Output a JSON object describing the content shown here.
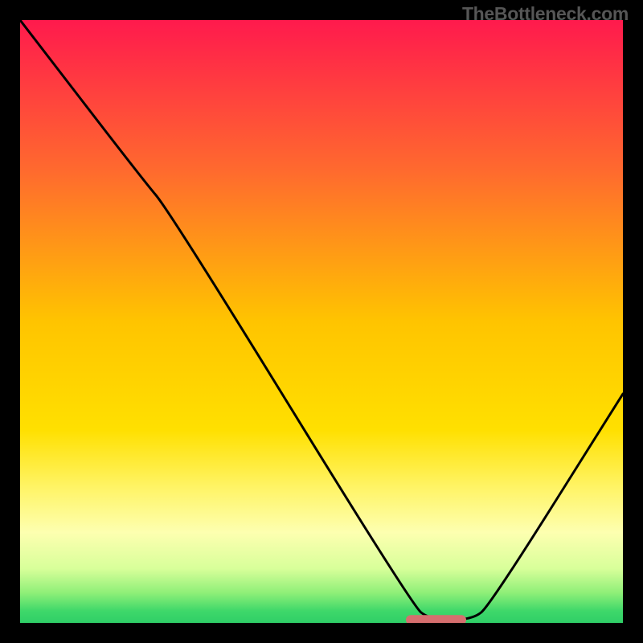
{
  "watermark": "TheBottleneck.com",
  "chart_data": {
    "type": "line",
    "title": "",
    "xlabel": "",
    "ylabel": "",
    "xlim": [
      0,
      100
    ],
    "ylim": [
      0,
      100
    ],
    "gradient_stops": [
      {
        "offset": 0,
        "color": "#ff1a4d"
      },
      {
        "offset": 25,
        "color": "#ff6a2e"
      },
      {
        "offset": 50,
        "color": "#ffc400"
      },
      {
        "offset": 68,
        "color": "#ffe000"
      },
      {
        "offset": 78,
        "color": "#fff56b"
      },
      {
        "offset": 85,
        "color": "#fdffb0"
      },
      {
        "offset": 91,
        "color": "#d8ff9a"
      },
      {
        "offset": 95,
        "color": "#8fef78"
      },
      {
        "offset": 98,
        "color": "#3fd86a"
      },
      {
        "offset": 100,
        "color": "#2fce67"
      }
    ],
    "curve_points": [
      {
        "x": 0,
        "y": 100
      },
      {
        "x": 20,
        "y": 74
      },
      {
        "x": 25,
        "y": 68
      },
      {
        "x": 65,
        "y": 3
      },
      {
        "x": 68,
        "y": 0.5
      },
      {
        "x": 75,
        "y": 0.5
      },
      {
        "x": 78,
        "y": 3
      },
      {
        "x": 100,
        "y": 38
      }
    ],
    "marker": {
      "x_start": 64,
      "x_end": 74,
      "y": 0.5,
      "color": "#d66f6f"
    }
  }
}
